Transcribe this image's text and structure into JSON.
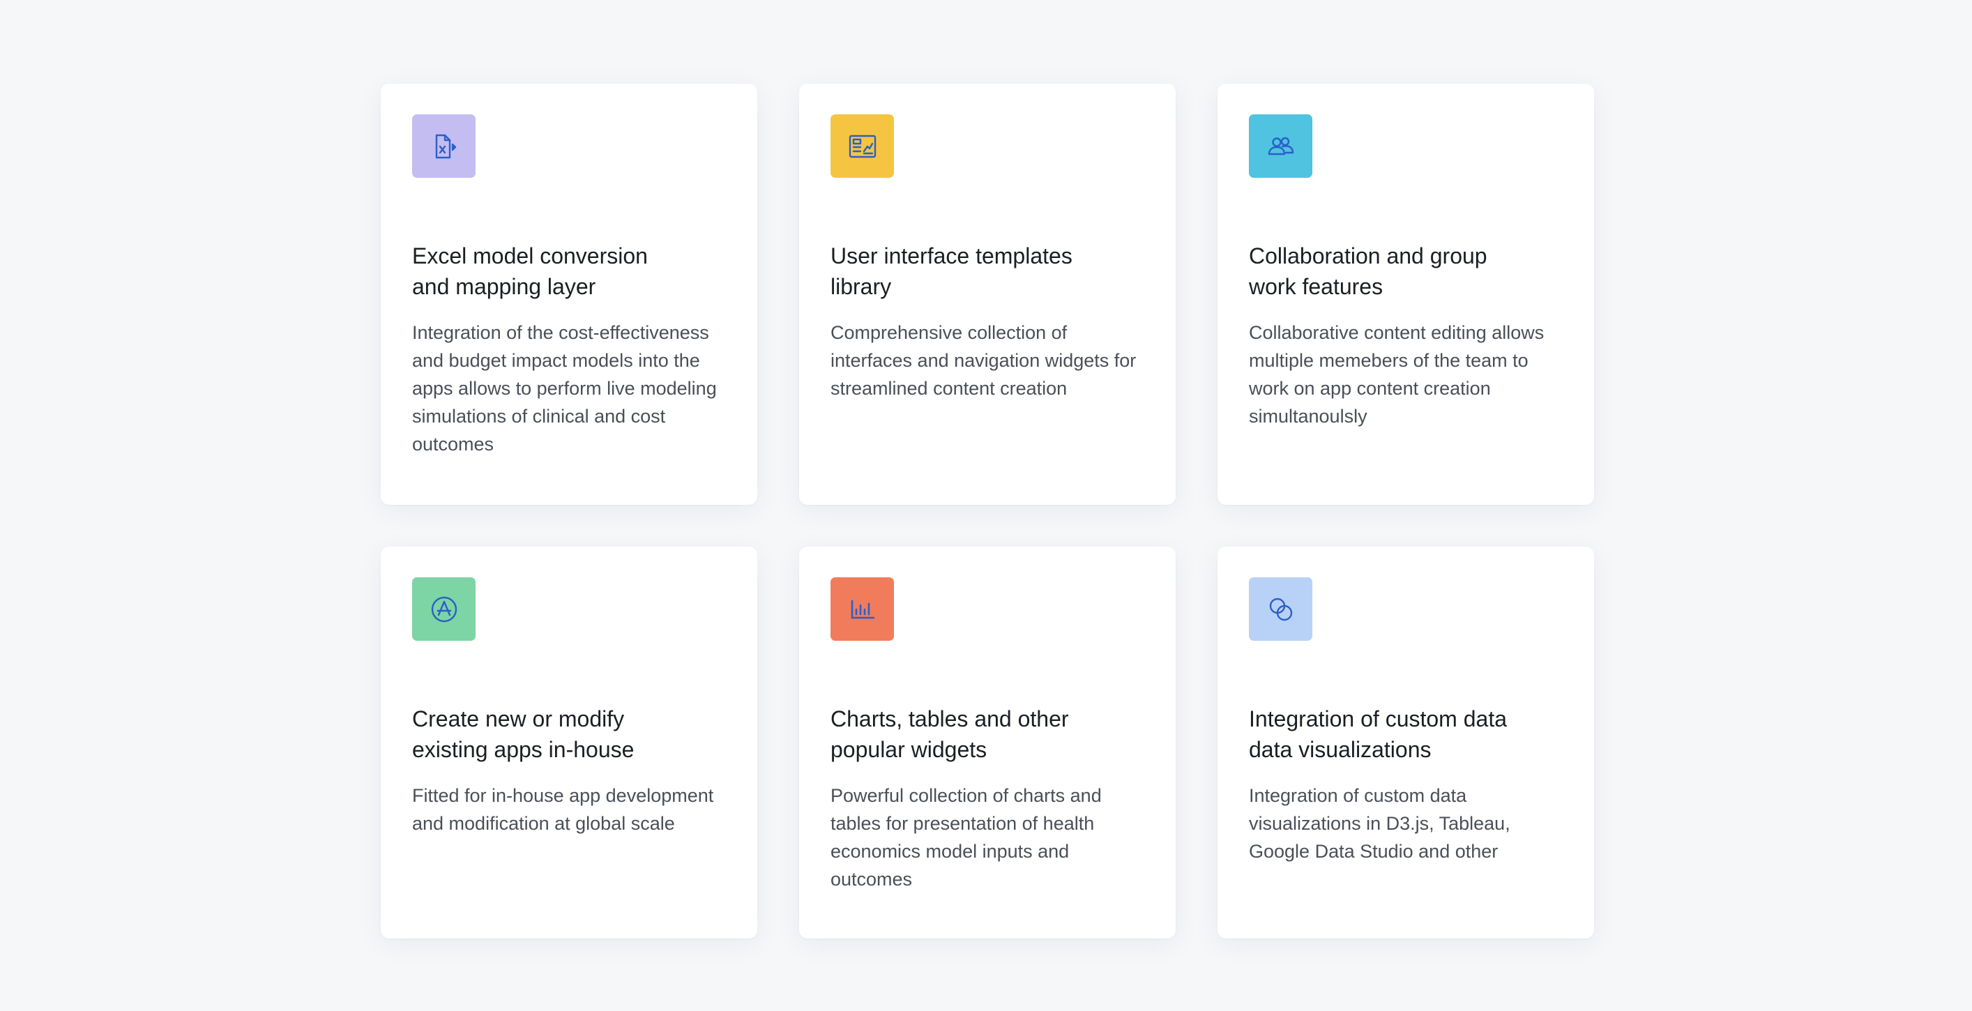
{
  "colors": {
    "page_bg": "#f6f7f9",
    "card_bg": "#ffffff",
    "icon_stroke": "#2b5fc8",
    "title": "#1b1e24",
    "text": "#4a4f57"
  },
  "features": [
    {
      "icon": "excel-file-icon",
      "tile_color": "#c3bdf2",
      "title": "Excel model conversion and mapping layer",
      "description": "Integration of the cost-effectiveness and budget impact models into the apps allows to perform live modeling simulations of clinical and cost outcomes"
    },
    {
      "icon": "template-layout-icon",
      "tile_color": "#f5c542",
      "title": "User interface templates library",
      "description": "Comprehensive collection of interfaces and navigation widgets for streamlined content creation"
    },
    {
      "icon": "users-group-icon",
      "tile_color": "#4fc3df",
      "title": "Collaboration and group work features",
      "description": "Collaborative content editing allows multiple memebers of the team to work on app content creation simultanoulsly"
    },
    {
      "icon": "app-store-icon",
      "tile_color": "#7dd4a4",
      "title": "Create new or modify existing apps in-house",
      "description": "Fitted for in-house app development and modification at global scale"
    },
    {
      "icon": "bar-chart-icon",
      "tile_color": "#f07c5c",
      "title": "Charts, tables and other popular widgets",
      "description": "Powerful collection of charts and tables for presentation of health economics model inputs and outcomes"
    },
    {
      "icon": "overlapping-circles-icon",
      "tile_color": "#b8d1f7",
      "title": "Integration of custom data data visualizations",
      "description": "Integration of custom data visualizations in D3.js, Tableau, Google Data Studio and other"
    }
  ]
}
